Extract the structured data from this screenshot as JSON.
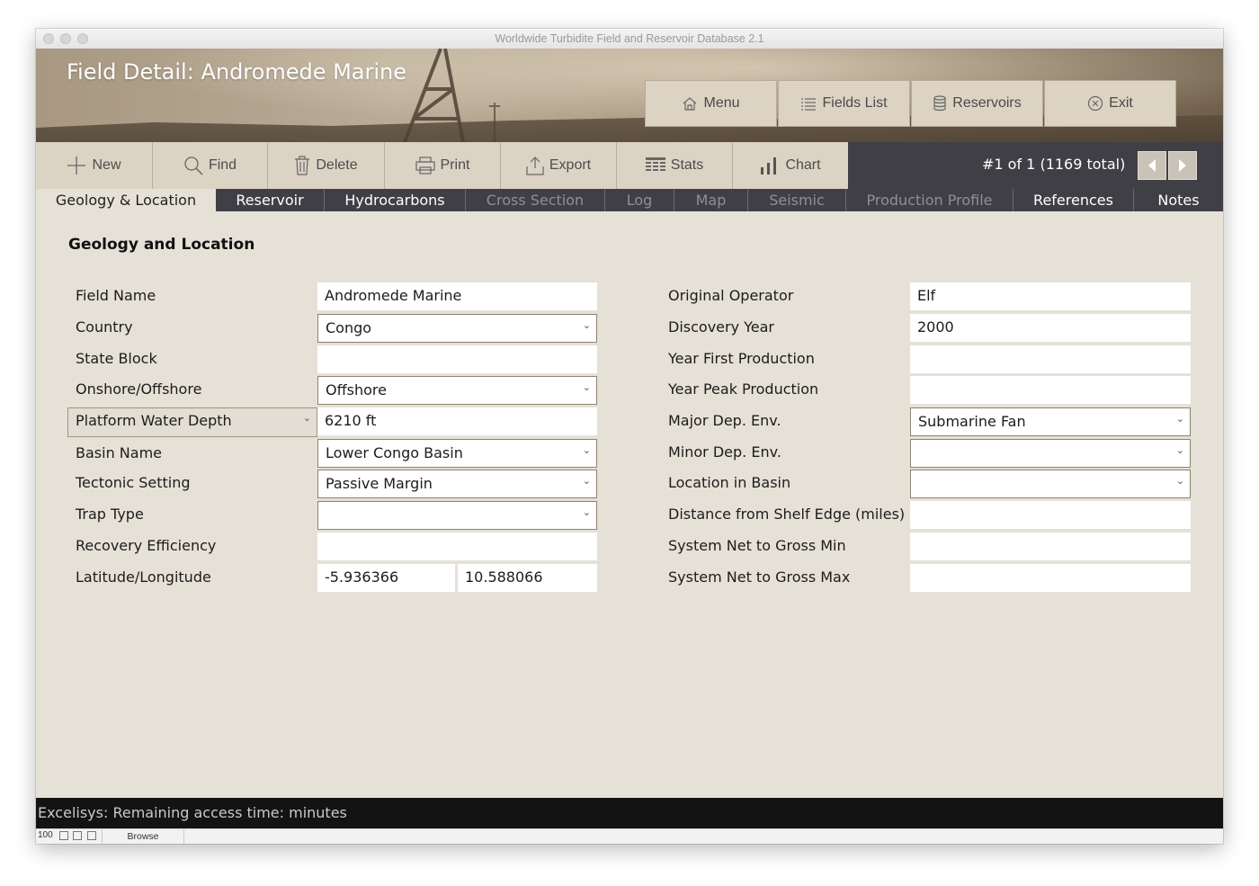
{
  "window": {
    "title": "Worldwide Turbidite Field and Reservoir Database 2.1"
  },
  "header": {
    "title": "Field Detail: Andromede Marine",
    "nav": [
      {
        "label": "Menu",
        "icon": "home-icon"
      },
      {
        "label": "Fields List",
        "icon": "list-icon"
      },
      {
        "label": "Reservoirs",
        "icon": "database-icon"
      },
      {
        "label": "Exit",
        "icon": "close-circle-icon"
      }
    ]
  },
  "toolbar": {
    "buttons": [
      {
        "label": "New",
        "icon": "plus-icon"
      },
      {
        "label": "Find",
        "icon": "search-icon"
      },
      {
        "label": "Delete",
        "icon": "trash-icon"
      },
      {
        "label": "Print",
        "icon": "printer-icon"
      },
      {
        "label": "Export",
        "icon": "export-icon"
      },
      {
        "label": "Stats",
        "icon": "table-icon"
      },
      {
        "label": "Chart",
        "icon": "bar-chart-icon"
      }
    ],
    "record_info": "#1 of 1  (1169 total)"
  },
  "tabs": [
    {
      "label": "Geology & Location",
      "state": "active"
    },
    {
      "label": "Reservoir",
      "state": "enabled"
    },
    {
      "label": "Hydrocarbons",
      "state": "enabled"
    },
    {
      "label": "Cross Section",
      "state": "disabled"
    },
    {
      "label": "Log",
      "state": "disabled"
    },
    {
      "label": "Map",
      "state": "disabled"
    },
    {
      "label": "Seismic",
      "state": "disabled"
    },
    {
      "label": "Production Profile",
      "state": "disabled"
    },
    {
      "label": "References",
      "state": "enabled"
    },
    {
      "label": "Notes",
      "state": "enabled"
    }
  ],
  "section": {
    "title": "Geology and Location"
  },
  "left_fields": [
    {
      "label": "Field Name",
      "value": "Andromede Marine",
      "type": "text"
    },
    {
      "label": "Country",
      "value": "Congo",
      "type": "select"
    },
    {
      "label": "State Block",
      "value": "",
      "type": "text"
    },
    {
      "label": "Onshore/Offshore",
      "value": "Offshore",
      "type": "select"
    },
    {
      "label": "Platform Water Depth",
      "value": "6210 ft",
      "type": "text"
    },
    {
      "label": "Basin Name",
      "value": "Lower Congo Basin",
      "type": "select"
    },
    {
      "label": "Tectonic Setting",
      "value": "Passive Margin",
      "type": "select"
    },
    {
      "label": "Trap Type",
      "value": "",
      "type": "select"
    },
    {
      "label": "Recovery Efficiency",
      "value": "",
      "type": "text"
    },
    {
      "label": "Latitude/Longitude",
      "latitude": "-5.936366",
      "longitude": "10.588066",
      "type": "pair"
    }
  ],
  "right_fields": [
    {
      "label": "Original Operator",
      "value": "Elf",
      "type": "text"
    },
    {
      "label": "Discovery Year",
      "value": "2000",
      "type": "text"
    },
    {
      "label": "Year First Production",
      "value": "",
      "type": "text"
    },
    {
      "label": "Year Peak Production",
      "value": "",
      "type": "text"
    },
    {
      "label": "Major Dep. Env.",
      "value": "Submarine Fan",
      "type": "select"
    },
    {
      "label": "Minor Dep. Env.",
      "value": "",
      "type": "select"
    },
    {
      "label": "Location in Basin",
      "value": "",
      "type": "select"
    },
    {
      "label": "Distance from Shelf Edge (miles)",
      "value": "",
      "type": "text"
    },
    {
      "label": "System Net to Gross Min",
      "value": "",
      "type": "text"
    },
    {
      "label": "System Net to Gross Max",
      "value": "",
      "type": "text"
    }
  ],
  "status": {
    "text": "Excelisys: Remaining access time:  minutes"
  },
  "bottom": {
    "zoom": "100",
    "mode": "Browse"
  }
}
